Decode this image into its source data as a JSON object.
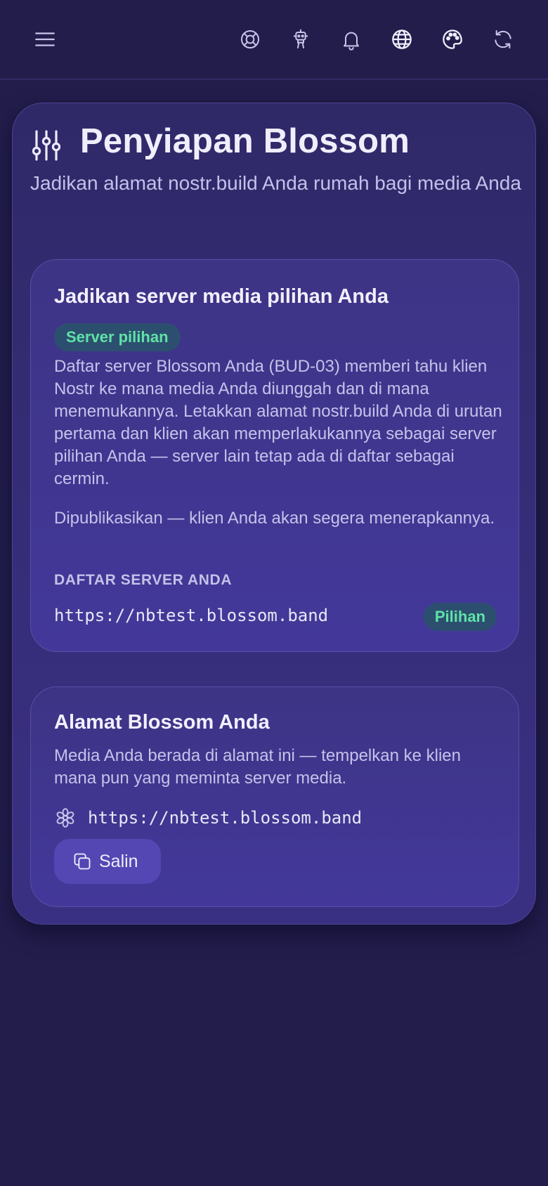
{
  "topbar": {
    "icons": [
      "menu-icon",
      "lifebuoy-icon",
      "robot-icon",
      "bell-icon",
      "globe-icon",
      "palette-icon",
      "refresh-icon"
    ]
  },
  "page": {
    "title": "Penyiapan Blossom",
    "subtitle": "Jadikan alamat nostr.build Anda rumah bagi media Anda",
    "header_icon": "sliders-icon"
  },
  "preferred_card": {
    "title": "Jadikan server media pilihan Anda",
    "badge": "Server pilihan",
    "description": "Daftar server Blossom Anda (BUD-03) memberi tahu klien Nostr ke mana media Anda diunggah dan di mana menemukannya. Letakkan alamat nostr.build Anda di urutan pertama dan klien akan memperlakukannya sebagai server pilihan Anda — server lain tetap ada di daftar sebagai cermin.",
    "status": "Dipublikasikan — klien Anda akan segera menerapkannya.",
    "list_label": "DAFTAR SERVER ANDA",
    "servers": [
      {
        "url": "https://nbtest.blossom.band",
        "tag": "Pilihan"
      }
    ]
  },
  "address_card": {
    "title": "Alamat Blossom Anda",
    "description": "Media Anda berada di alamat ini — tempelkan ke klien mana pun yang meminta server media.",
    "address_icon": "flower-icon",
    "address": "https://nbtest.blossom.band",
    "copy_label": "Salin"
  },
  "colors": {
    "background": "#221d4b",
    "accent_green": "#5fe3a8",
    "button": "#5447b4"
  }
}
